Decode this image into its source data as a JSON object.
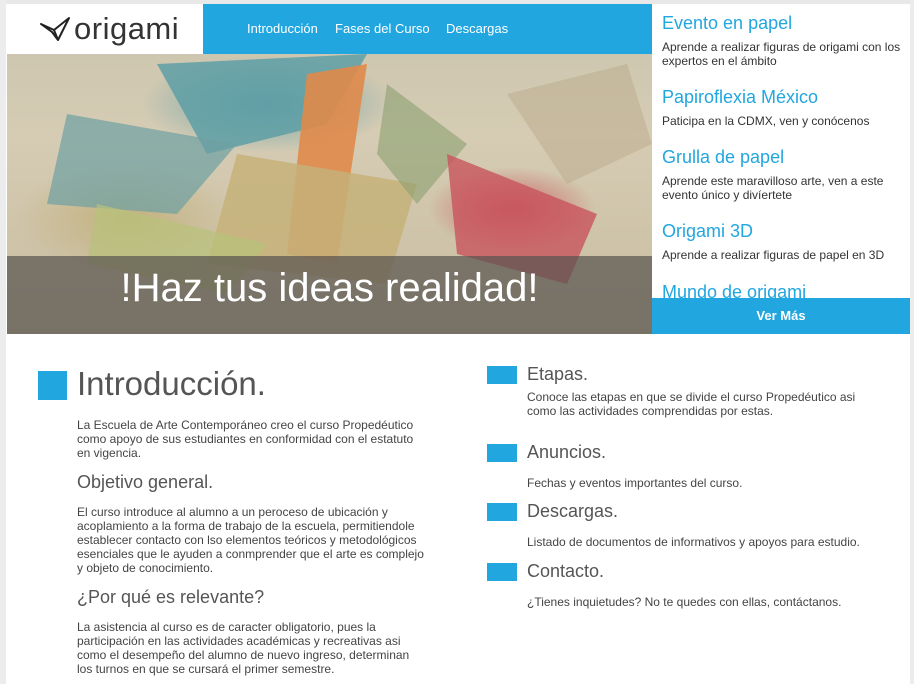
{
  "brand": {
    "logo_text": "origami"
  },
  "nav": {
    "items": [
      "Introducción",
      "Fases del Curso",
      "Descargas"
    ]
  },
  "hero": {
    "headline": "!Haz tus ideas realidad!"
  },
  "events": {
    "items": [
      {
        "title": "Evento en papel",
        "desc": "Aprende a realizar figuras de origami con los expertos en el ámbito"
      },
      {
        "title": "Papiroflexia México",
        "desc": "Paticipa en la CDMX, ven y conócenos"
      },
      {
        "title": "Grulla de papel",
        "desc": "Aprende este maravilloso arte, ven a este evento único y divíertete"
      },
      {
        "title": "Origami 3D",
        "desc": "Aprende a realizar figuras de papel en 3D"
      },
      {
        "title": "Mundo de origami",
        "desc": ""
      }
    ],
    "more_label": "Ver Más"
  },
  "intro": {
    "title": "Introducción.",
    "text": "La Escuela de Arte Contemporáneo creo el curso Propedéutico como apoyo de sus estudiantes en conformidad con el estatuto en vigencia.",
    "objective_title": "Objetivo general.",
    "objective_text": "El curso introduce al alumno a un peroceso de ubicación y acoplamiento a la forma de trabajo de la escuela, permitiendole establecer contacto con lso elementos teóricos y metodológicos esenciales que le ayuden a conmprender que el arte es complejo y objeto de conocimiento.",
    "relevance_title": "¿Por qué es relevante?",
    "relevance_text": "La asistencia al curso es de caracter obligatorio, pues la participación en las actividades académicas y recreativas asi como el desempeño del alumno de nuevo ingreso, determinan los turnos en que se cursará el primer semestre."
  },
  "sections": [
    {
      "title": "Etapas.",
      "text": "Conoce las etapas en que se divide el curso Propedéutico asi como las actividades comprendidas por estas."
    },
    {
      "title": "Anuncios.",
      "text": "Fechas y eventos importantes del curso."
    },
    {
      "title": "Descargas.",
      "text": "Listado de documentos de informativos y apoyos para estudio."
    },
    {
      "title": "Contacto.",
      "text": "¿Tienes inquietudes? No te quedes con ellas, contáctanos."
    }
  ],
  "colors": {
    "accent": "#21a6e0"
  }
}
